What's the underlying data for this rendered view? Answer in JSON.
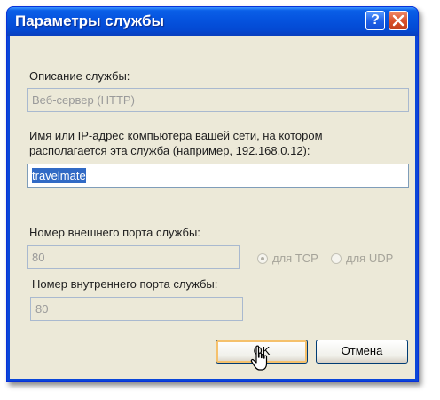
{
  "window": {
    "title": "Параметры службы"
  },
  "titlebar": {
    "help_label": "?"
  },
  "service_description": {
    "label": "Описание службы:",
    "value": "Веб-сервер (HTTP)"
  },
  "host": {
    "label_line1": "Имя или IP-адрес компьютера вашей сети, на котором",
    "label_line2": "располагается эта служба (например, 192.168.0.12):",
    "value": "travelmate"
  },
  "external_port": {
    "label": "Номер внешнего порта службы:",
    "value": "80"
  },
  "protocol": {
    "tcp_label": "для TCP",
    "udp_label": "для UDP",
    "selected": "tcp"
  },
  "internal_port": {
    "label": "Номер внутреннего порта службы:",
    "value": "80"
  },
  "buttons": {
    "ok_label": "OK",
    "cancel_label": "Отмена"
  },
  "colors": {
    "title_bar": "#0553de",
    "client": "#ece9d8",
    "selection": "#316ac5",
    "close_button": "#d8502a"
  }
}
